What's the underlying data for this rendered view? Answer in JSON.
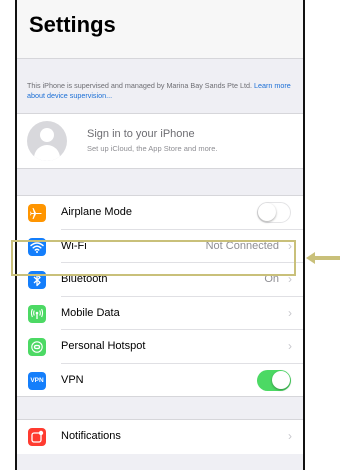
{
  "header": {
    "title": "Settings"
  },
  "supervision": {
    "text": "This iPhone is supervised and managed by Marina Bay Sands Pte Ltd.",
    "link": "Learn more about device supervision..."
  },
  "account": {
    "title": "Sign in to your iPhone",
    "subtitle": "Set up iCloud, the App Store and more."
  },
  "settings": [
    {
      "label": "Airplane Mode",
      "icon": "airplane-icon",
      "color": "#ff9500",
      "control": "toggle",
      "state": "off"
    },
    {
      "label": "Wi-Fi",
      "icon": "wifi-icon",
      "color": "#147efb",
      "detail": "Not Connected",
      "highlighted": true
    },
    {
      "label": "Bluetooth",
      "icon": "bluetooth-icon",
      "color": "#147efb",
      "detail": "On"
    },
    {
      "label": "Mobile Data",
      "icon": "antenna-icon",
      "color": "#4cd964",
      "detail": ""
    },
    {
      "label": "Personal Hotspot",
      "icon": "hotspot-icon",
      "color": "#4cd964",
      "detail": ""
    },
    {
      "label": "VPN",
      "icon": "vpn-icon",
      "color": "#147efb",
      "control": "toggle",
      "state": "on",
      "icon_text": "VPN"
    }
  ],
  "notifications": {
    "label": "Notifications",
    "icon": "notifications-icon",
    "color": "#ff3b30"
  },
  "annotation": {
    "highlight_color": "#c9c07a",
    "arrow_color": "#c9c07a"
  }
}
